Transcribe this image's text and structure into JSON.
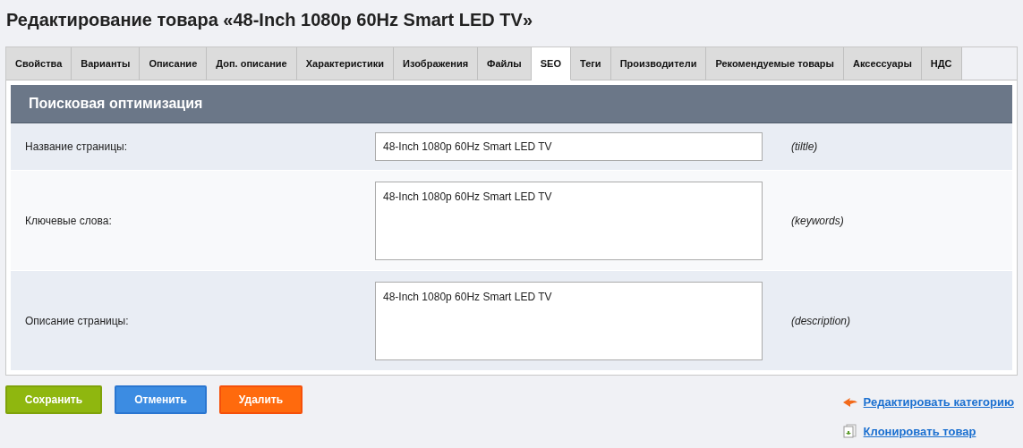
{
  "title": "Редактирование товара «48-Inch 1080p 60Hz Smart LED TV»",
  "tabs": [
    {
      "label": "Свойства",
      "selected": false
    },
    {
      "label": "Варианты",
      "selected": false
    },
    {
      "label": "Описание",
      "selected": false
    },
    {
      "label": "Доп. описание",
      "selected": false
    },
    {
      "label": "Характеристики",
      "selected": false
    },
    {
      "label": "Изображения",
      "selected": false
    },
    {
      "label": "Файлы",
      "selected": false
    },
    {
      "label": "SEO",
      "selected": true
    },
    {
      "label": "Теги",
      "selected": false
    },
    {
      "label": "Производители",
      "selected": false
    },
    {
      "label": "Рекомендуемые товары",
      "selected": false
    },
    {
      "label": "Аксессуары",
      "selected": false
    },
    {
      "label": "НДС",
      "selected": false
    }
  ],
  "section": {
    "title": "Поисковая оптимизация"
  },
  "fields": [
    {
      "kind": "input",
      "label": "Название страницы:",
      "value": "48-Inch 1080p 60Hz Smart LED TV",
      "hint": "(tiltle)"
    },
    {
      "kind": "textarea",
      "label": "Ключевые слова:",
      "value": "48-Inch 1080p 60Hz Smart LED TV",
      "hint": "(keywords)"
    },
    {
      "kind": "textarea",
      "label": "Описание страницы:",
      "value": "48-Inch 1080p 60Hz Smart LED TV",
      "hint": "(description)"
    }
  ],
  "buttons": [
    {
      "kind": "save",
      "label": "Сохранить"
    },
    {
      "kind": "cancel",
      "label": "Отменить"
    },
    {
      "kind": "delete",
      "label": "Удалить"
    }
  ],
  "links": [
    {
      "kind": "edit",
      "label": "Редактировать категорию"
    },
    {
      "kind": "clone",
      "label": "Клонировать товар"
    }
  ]
}
